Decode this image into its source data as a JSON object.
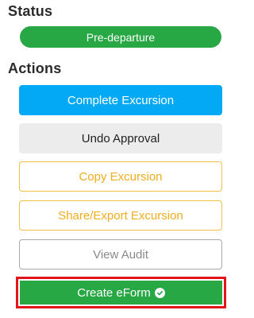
{
  "status": {
    "title": "Status",
    "badge": "Pre-departure",
    "badge_color": "#28a745"
  },
  "actions": {
    "title": "Actions",
    "complete_excursion": "Complete Excursion",
    "undo_approval": "Undo Approval",
    "copy_excursion": "Copy Excursion",
    "share_export_excursion": "Share/Export Excursion",
    "view_audit": "View Audit",
    "create_eform": "Create eForm",
    "create_eform_icon": "check-circle-icon",
    "highlight_color": "#e4141b"
  }
}
